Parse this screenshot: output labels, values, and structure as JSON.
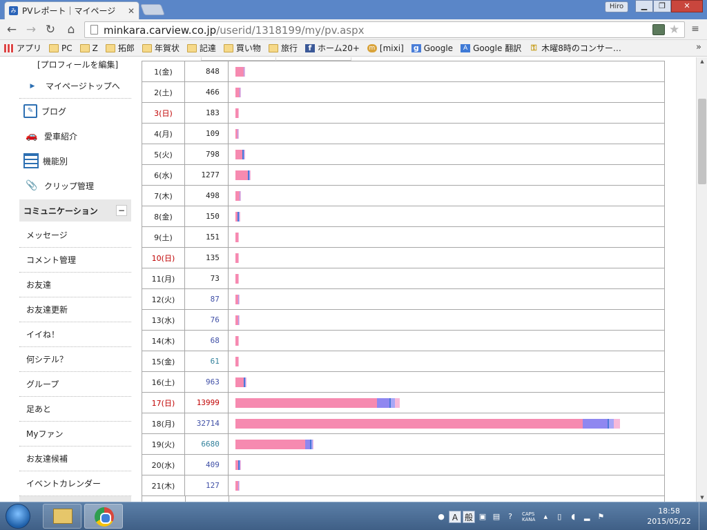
{
  "browser": {
    "tab_title": "PVレポート｜マイページ",
    "tab_favicon_text": "み",
    "user_badge": "Hiro",
    "url_host": "minkara.carview.co.jp",
    "url_path": "/userid/1318199/my/pv.aspx"
  },
  "bookmarks": [
    {
      "label": "アプリ",
      "icon": "apps-icon",
      "kind": "apps"
    },
    {
      "label": "PC",
      "icon": "folder-icon",
      "kind": "folder"
    },
    {
      "label": "Z",
      "icon": "folder-icon",
      "kind": "folder"
    },
    {
      "label": "拓郎",
      "icon": "folder-icon",
      "kind": "folder"
    },
    {
      "label": "年賀状",
      "icon": "folder-icon",
      "kind": "folder"
    },
    {
      "label": "記達",
      "icon": "folder-icon",
      "kind": "folder"
    },
    {
      "label": "買い物",
      "icon": "folder-icon",
      "kind": "folder"
    },
    {
      "label": "旅行",
      "icon": "folder-icon",
      "kind": "folder"
    },
    {
      "label": "ホーム20+",
      "icon": "facebook-icon",
      "kind": "fb"
    },
    {
      "label": "[mixi]",
      "icon": "mixi-icon",
      "kind": "mixi"
    },
    {
      "label": "Google",
      "icon": "google-icon",
      "kind": "google"
    },
    {
      "label": "Google 翻訳",
      "icon": "translate-icon",
      "kind": "translate"
    },
    {
      "label": "木曜8時のコンサー…",
      "icon": "key-icon",
      "kind": "key"
    }
  ],
  "sidebar": {
    "profile_edit": "[プロフィールを編集]",
    "mypage_top": "マイページトップへ",
    "blog": "ブログ",
    "car": "愛車紹介",
    "features": "機能別",
    "clip": "クリップ管理",
    "section_title": "コミュニケーション",
    "collapse_symbol": "−",
    "items": [
      "メッセージ",
      "コメント管理",
      "お友達",
      "お友達更新",
      "イイね！",
      "何シテル？",
      "グループ",
      "足あと",
      "Myファン",
      "お友達候補",
      "イベントカレンダー"
    ]
  },
  "pv_rows": [
    {
      "date": "1(金)",
      "pv": "848",
      "sun": false,
      "color": "black",
      "segs": [
        12,
        0,
        0,
        1,
        1
      ]
    },
    {
      "date": "2(土)",
      "pv": "466",
      "sun": false,
      "color": "black",
      "segs": [
        6,
        0,
        0,
        1,
        1
      ]
    },
    {
      "date": "3(日)",
      "pv": "183",
      "sun": true,
      "color": "black",
      "segs": [
        4,
        0,
        0,
        0,
        1
      ]
    },
    {
      "date": "4(月)",
      "pv": "109",
      "sun": false,
      "color": "black",
      "segs": [
        3,
        0,
        0,
        1,
        1
      ]
    },
    {
      "date": "5(火)",
      "pv": "798",
      "sun": false,
      "color": "black",
      "segs": [
        10,
        0,
        2,
        1,
        1
      ]
    },
    {
      "date": "6(水)",
      "pv": "1277",
      "sun": false,
      "color": "black",
      "segs": [
        18,
        0,
        2,
        1,
        1
      ]
    },
    {
      "date": "7(木)",
      "pv": "498",
      "sun": false,
      "color": "black",
      "segs": [
        6,
        0,
        0,
        1,
        1
      ]
    },
    {
      "date": "8(金)",
      "pv": "150",
      "sun": false,
      "color": "black",
      "segs": [
        3,
        0,
        2,
        1,
        1
      ]
    },
    {
      "date": "9(土)",
      "pv": "151",
      "sun": false,
      "color": "black",
      "segs": [
        4,
        0,
        0,
        0,
        1
      ]
    },
    {
      "date": "10(日)",
      "pv": "135",
      "sun": true,
      "color": "black",
      "segs": [
        4,
        0,
        0,
        0,
        1
      ]
    },
    {
      "date": "11(月)",
      "pv": "73",
      "sun": false,
      "color": "black",
      "segs": [
        4,
        0,
        0,
        0,
        1
      ]
    },
    {
      "date": "12(火)",
      "pv": "87",
      "sun": false,
      "color": "blue",
      "segs": [
        4,
        0,
        0,
        1,
        1
      ]
    },
    {
      "date": "13(水)",
      "pv": "76",
      "sun": false,
      "color": "blue",
      "segs": [
        4,
        0,
        0,
        1,
        1
      ]
    },
    {
      "date": "14(木)",
      "pv": "68",
      "sun": false,
      "color": "blue",
      "segs": [
        4,
        0,
        0,
        0,
        1
      ]
    },
    {
      "date": "15(金)",
      "pv": "61",
      "sun": false,
      "color": "green",
      "segs": [
        4,
        0,
        0,
        0,
        1
      ]
    },
    {
      "date": "16(土)",
      "pv": "963",
      "sun": false,
      "color": "blue",
      "segs": [
        12,
        0,
        2,
        1,
        1
      ]
    },
    {
      "date": "17(日)",
      "pv": "13999",
      "sun": true,
      "color": "red",
      "segs": [
        205,
        18,
        2,
        6,
        7
      ]
    },
    {
      "date": "18(月)",
      "pv": "32714",
      "sun": false,
      "color": "blue",
      "segs": [
        503,
        36,
        2,
        7,
        9
      ]
    },
    {
      "date": "19(火)",
      "pv": "6680",
      "sun": false,
      "color": "green",
      "segs": [
        101,
        7,
        2,
        2,
        1
      ]
    },
    {
      "date": "20(水)",
      "pv": "409",
      "sun": false,
      "color": "blue",
      "segs": [
        4,
        0,
        2,
        1,
        1
      ]
    },
    {
      "date": "21(木)",
      "pv": "127",
      "sun": false,
      "color": "blue",
      "segs": [
        4,
        0,
        0,
        1,
        1
      ]
    }
  ],
  "taskbar": {
    "caps_line1": "CAPS",
    "caps_line2": "KANA",
    "ime_a": "A",
    "ime_mode": "般",
    "time": "18:58",
    "date": "2015/05/22"
  }
}
